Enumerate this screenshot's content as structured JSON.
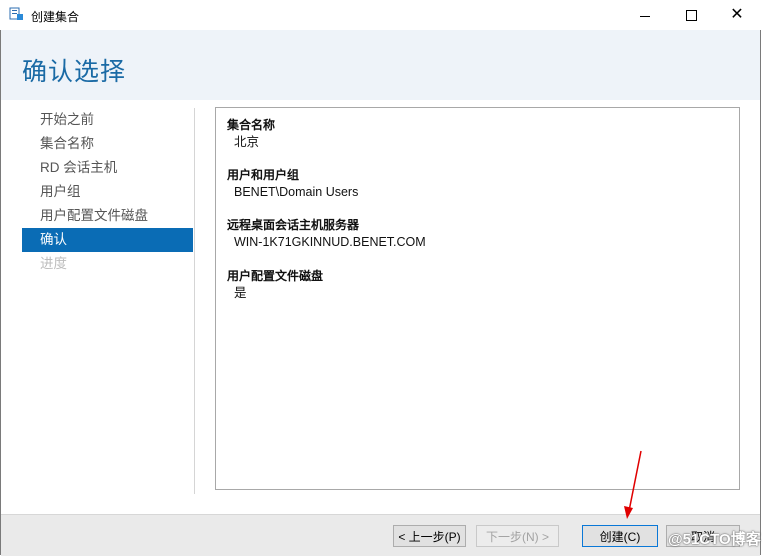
{
  "window": {
    "title": "创建集合",
    "icon": "server-collection-icon"
  },
  "page_title": "确认选择",
  "nav": {
    "items": [
      {
        "label": "开始之前",
        "state": "normal"
      },
      {
        "label": "集合名称",
        "state": "normal"
      },
      {
        "label": "RD 会话主机",
        "state": "normal"
      },
      {
        "label": "用户组",
        "state": "normal"
      },
      {
        "label": "用户配置文件磁盘",
        "state": "normal"
      },
      {
        "label": "确认",
        "state": "active"
      },
      {
        "label": "进度",
        "state": "disabled"
      }
    ]
  },
  "summary": [
    {
      "label": "集合名称",
      "value": "北京"
    },
    {
      "label": "用户和用户组",
      "value": "BENET\\Domain Users"
    },
    {
      "label": "远程桌面会话主机服务器",
      "value": "WIN-1K71GKINNUD.BENET.COM"
    },
    {
      "label": "用户配置文件磁盘",
      "value": "是"
    }
  ],
  "buttons": {
    "prev": "< 上一步(P)",
    "next": "下一步(N) >",
    "create": "创建(C)",
    "cancel": "取消"
  },
  "watermark": "@51CTO博客",
  "colors": {
    "accent": "#0a6cb5",
    "title": "#1a6aa5",
    "arrow": "#e00000",
    "header_bg": "#eef3f9"
  }
}
